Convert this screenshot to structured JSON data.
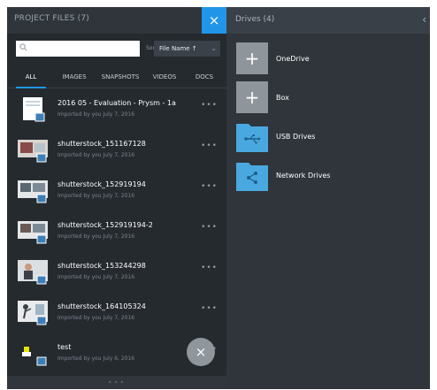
{
  "left_panel": {
    "title": "PROJECT FILES (7)",
    "close_glyph": "×",
    "search": {
      "value": "",
      "placeholder": ""
    },
    "sort": {
      "label": "Sort",
      "value": "File Name ↑"
    },
    "tabs": [
      {
        "label": "ALL",
        "active": true
      },
      {
        "label": "IMAGES",
        "active": false
      },
      {
        "label": "SNAPSHOTS",
        "active": false
      },
      {
        "label": "VIDEOS",
        "active": false
      },
      {
        "label": "DOCS",
        "active": false
      }
    ],
    "files": [
      {
        "name": "2016 05 - Evaluation - Prysm - 1a",
        "meta": "Imported by you July 7, 2016",
        "kind": "document"
      },
      {
        "name": "shutterstock_151167128",
        "meta": "Imported by you July 7, 2016",
        "kind": "image"
      },
      {
        "name": "shutterstock_152919194",
        "meta": "Imported by you July 7, 2016",
        "kind": "image"
      },
      {
        "name": "shutterstock_152919194-2",
        "meta": "Imported by you July 7, 2016",
        "kind": "image"
      },
      {
        "name": "shutterstock_153244298",
        "meta": "Imported by you July 7, 2016",
        "kind": "image"
      },
      {
        "name": "shutterstock_164105324",
        "meta": "Imported by you July 7, 2016",
        "kind": "image"
      },
      {
        "name": "test",
        "meta": "Imported by you July 6, 2016",
        "kind": "image"
      }
    ],
    "more_glyph": "•••",
    "fab_glyph": "×",
    "footer_glyph": "•••"
  },
  "right_panel": {
    "title": "Drives (4)",
    "back_glyph": "‹",
    "drives": [
      {
        "label": "OneDrive",
        "tile": "plus",
        "icon": "plus-icon"
      },
      {
        "label": "Box",
        "tile": "plus",
        "icon": "plus-icon"
      },
      {
        "label": "USB Drives",
        "tile": "folder",
        "icon": "usb-icon"
      },
      {
        "label": "Network Drives",
        "tile": "folder",
        "icon": "network-icon"
      }
    ],
    "plus_glyph": "+"
  },
  "colors": {
    "accent": "#2196e8",
    "folder": "#4aa8e0",
    "panel_dark": "#252a2f",
    "panel_mid": "#2f353b"
  }
}
